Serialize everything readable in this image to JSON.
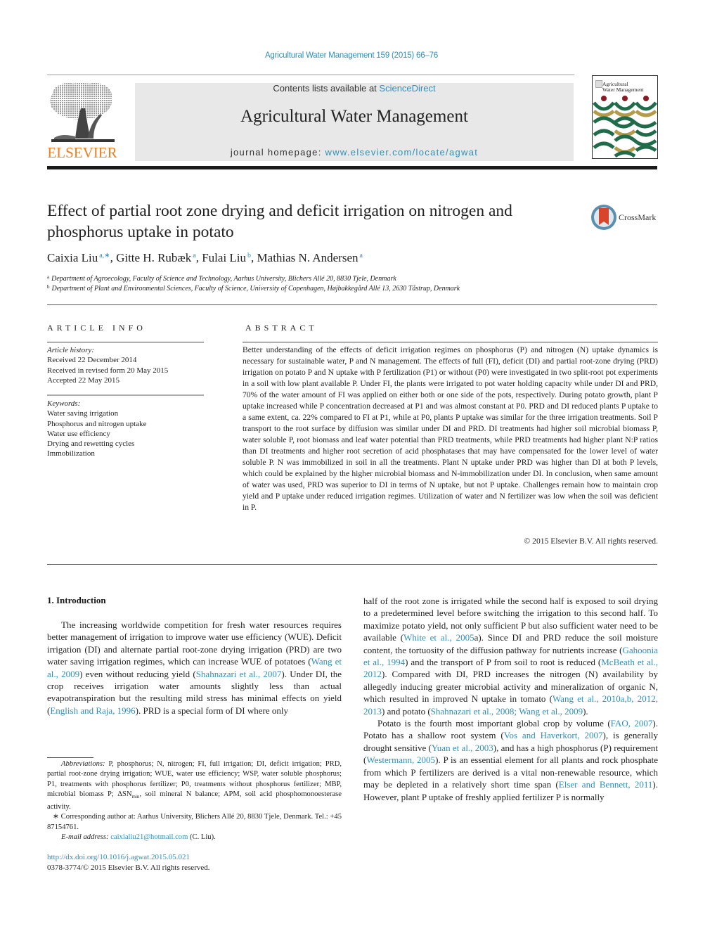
{
  "header": {
    "journal_reference": "Agricultural Water Management 159 (2015) 66–76",
    "contents_prefix": "Contents lists available at ",
    "contents_link": "ScienceDirect",
    "journal_title": "Agricultural Water Management",
    "homepage_prefix": "journal homepage: ",
    "homepage_link": "www.elsevier.com/locate/agwat",
    "publisher_logo_text": "ELSEVIER",
    "cover_title_line1": "Agricultural",
    "cover_title_line2": "Water Management",
    "colors": {
      "link": "#2e8fb8",
      "elsevier_orange": "#f07f1e",
      "banner_bg": "#e8e8e8",
      "cover_green": "#1f6b4a",
      "cover_gold": "#b39b4a",
      "cover_red": "#8a1a24"
    }
  },
  "article": {
    "title": "Effect of partial root zone drying and deficit irrigation on nitrogen and phosphorus uptake in potato",
    "crossmark_label": "CrossMark",
    "authors": [
      {
        "name": "Caixia Liu",
        "sup": "a,∗"
      },
      {
        "name": "Gitte H. Rubæk",
        "sup": "a"
      },
      {
        "name": "Fulai Liu",
        "sup": "b"
      },
      {
        "name": "Mathias N. Andersen",
        "sup": "a"
      }
    ],
    "affiliations": [
      {
        "mark": "a",
        "text": "Department of Agroecology, Faculty of Science and Technology, Aarhus University, Blichers Allé 20, 8830 Tjele, Denmark"
      },
      {
        "mark": "b",
        "text": "Department of Plant and Environmental Sciences, Faculty of Science, University of Copenhagen, Højbakkegård Allé 13, 2630 Tåstrup, Denmark"
      }
    ]
  },
  "article_info": {
    "heading": "ARTICLE INFO",
    "history_label": "Article history:",
    "history": [
      "Received 22 December 2014",
      "Received in revised form 20 May 2015",
      "Accepted 22 May 2015"
    ],
    "keywords_label": "Keywords:",
    "keywords": [
      "Water saving irrigation",
      "Phosphorus and nitrogen uptake",
      "Water use efficiency",
      "Drying and rewetting cycles",
      "Immobilization"
    ]
  },
  "abstract": {
    "heading": "ABSTRACT",
    "text": "Better understanding of the effects of deficit irrigation regimes on phosphorus (P) and nitrogen (N) uptake dynamics is necessary for sustainable water, P and N management. The effects of full (FI), deficit (DI) and partial root-zone drying (PRD) irrigation on potato P and N uptake with P fertilization (P1) or without (P0) were investigated in two split-root pot experiments in a soil with low plant available P. Under FI, the plants were irrigated to pot water holding capacity while under DI and PRD, 70% of the water amount of FI was applied on either both or one side of the pots, respectively. During potato growth, plant P uptake increased while P concentration decreased at P1 and was almost constant at P0. PRD and DI reduced plants P uptake to a same extent, ca. 22% compared to FI at P1, while at P0, plants P uptake was similar for the three irrigation treatments. Soil P transport to the root surface by diffusion was similar under DI and PRD. DI treatments had higher soil microbial biomass P, water soluble P, root biomass and leaf water potential than PRD treatments, while PRD treatments had higher plant N:P ratios than DI treatments and higher root secretion of acid phosphatases that may have compensated for the lower level of water soluble P. N was immobilized in soil in all the treatments. Plant N uptake under PRD was higher than DI at both P levels, which could be explained by the higher microbial biomass and N-immobilization under DI. In conclusion, when same amount of water was used, PRD was superior to DI in terms of N uptake, but not P uptake. Challenges remain how to maintain crop yield and P uptake under reduced irrigation regimes. Utilization of water and N fertilizer was low when the soil was deficient in P.",
    "copyright": "© 2015 Elsevier B.V. All rights reserved."
  },
  "introduction": {
    "heading": "1.  Introduction",
    "left_para": [
      {
        "t": "The increasing worldwide competition for fresh water resources requires better management of irrigation to improve water use efficiency (WUE). Deficit irrigation (DI) and alternate partial root-zone drying irrigation (PRD) are two water saving irrigation regimes, which can increase WUE of potatoes ("
      },
      {
        "link": "Wang et al., 2009"
      },
      {
        "t": ") even without reducing yield ("
      },
      {
        "link": "Shahnazari et al., 2007"
      },
      {
        "t": "). Under DI, the crop receives irrigation water amounts slightly less than actual evapotranspiration but the resulting mild stress has minimal effects on yield ("
      },
      {
        "link": "English and Raja, 1996"
      },
      {
        "t": "). PRD is a special form of DI where only"
      }
    ],
    "right_para1": [
      {
        "t": "half of the root zone is irrigated while the second half is exposed to soil drying to a predetermined level before switching the irrigation to this second half. To maximize potato yield, not only sufficient P but also sufficient water need to be available ("
      },
      {
        "link": "White et al., 2005"
      },
      {
        "t": "a). Since DI and PRD reduce the soil moisture content, the tortuosity of the diffusion pathway for nutrients increase ("
      },
      {
        "link": "Gahoonia et al., 1994"
      },
      {
        "t": ") and the transport of P from soil to root is reduced ("
      },
      {
        "link": "McBeath et al., 2012"
      },
      {
        "t": "). Compared with DI, PRD increases the nitrogen (N) availability by allegedly inducing greater microbial activity and mineralization of organic N, which resulted in improved N uptake in tomato ("
      },
      {
        "link": "Wang et al., 2010a,b, 2012, 2013"
      },
      {
        "t": ") and potato ("
      },
      {
        "link": "Shahnazari et al., 2008; Wang et al., 2009"
      },
      {
        "t": ")."
      }
    ],
    "right_para2": [
      {
        "t": "Potato is the fourth most important global crop by volume ("
      },
      {
        "link": "FAO, 2007"
      },
      {
        "t": "). Potato has a shallow root system ("
      },
      {
        "link": "Vos and Haverkort, 2007"
      },
      {
        "t": "), is generally drought sensitive ("
      },
      {
        "link": "Yuan et al., 2003"
      },
      {
        "t": "), and has a high phosphorus (P) requirement ("
      },
      {
        "link": "Westermann, 2005"
      },
      {
        "t": "). P is an essential element for all plants and rock phosphate from which P fertilizers are derived is a vital non-renewable resource, which may be depleted in a relatively short time span ("
      },
      {
        "link": "Elser and Bennett, 2011"
      },
      {
        "t": "). However, plant P uptake of freshly applied fertilizer P is normally"
      }
    ]
  },
  "footnotes": {
    "abbrev_label": "Abbreviations:",
    "abbrev_text_1": " P, phosphorus; N, nitrogen; FI, full irrigation; DI, deficit irrigation; PRD, partial root-zone drying irrigation; WUE, water use efficiency; WSP, water soluble phosphorus; P1, treatments with phosphorus fertilizer; P0, treatments without phosphorus fertilizer; MBP, microbial biomass P; ΔSN",
    "abbrev_sub": "min",
    "abbrev_text_2": ", soil mineral N balance; APM, soil acid phosphomonoesterase activity.",
    "corresponding": "∗  Corresponding author at: Aarhus University, Blichers Allé 20, 8830 Tjele, Denmark. Tel.: +45 87154761.",
    "email_label": "E-mail address:",
    "email": "caixialiu21@hotmail.com",
    "email_suffix": " (C. Liu).",
    "doi": "http://dx.doi.org/10.1016/j.agwat.2015.05.021",
    "issn_line": "0378-3774/© 2015 Elsevier B.V. All rights reserved."
  }
}
